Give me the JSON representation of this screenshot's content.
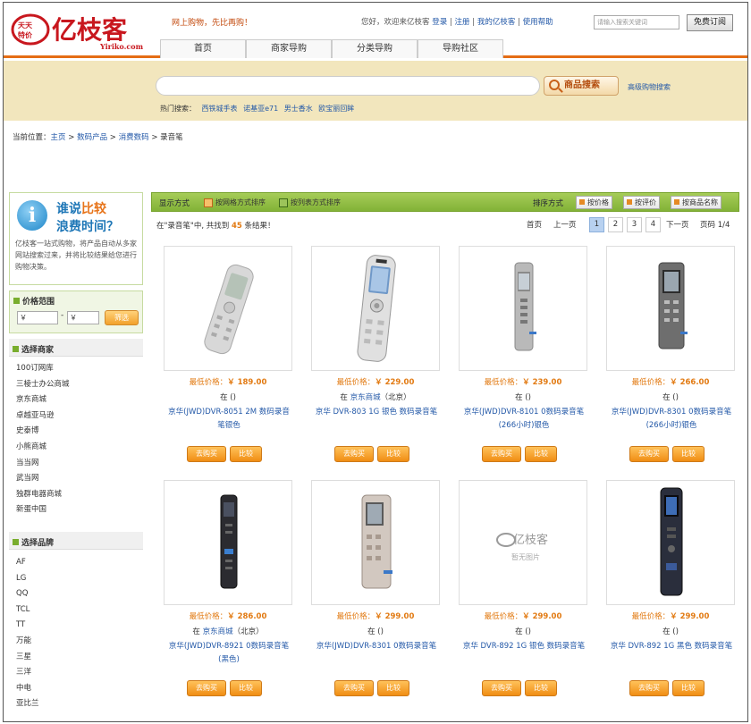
{
  "header": {
    "logo_badge": "天天特价",
    "logo_text": "亿枝客",
    "logo_domain": "Yiriko.com",
    "slogan": "网上购物，先比再购！",
    "welcome": "您好，欢迎来亿枝客",
    "links": [
      "登录",
      "注册",
      "我的亿枝客",
      "使用帮助"
    ],
    "search_placeholder": "请输入搜索关键词",
    "free_order": "免费订阅",
    "nav": [
      "首页",
      "商家导购",
      "分类导购",
      "导购社区"
    ]
  },
  "search": {
    "button": "商品搜索",
    "advanced": "高级购物搜索",
    "hot_label": "热门搜索：",
    "hot_keywords": [
      "西铁城手表",
      "诺基亚e71",
      "男士香水",
      "欧宝丽回眸"
    ]
  },
  "breadcrumb": {
    "label": "当前位置：",
    "items": [
      "主页",
      "数码产品",
      "消费数码",
      "录音笔"
    ],
    "sep": " > "
  },
  "sidebar": {
    "promo_line1a": "谁说",
    "promo_line1b": "比较",
    "promo_line2": "浪费时间？",
    "promo_desc": "亿枝客一站式购物，将产品自动从多家网站搜索过来，并将比较结果给您进行购物决策。",
    "price_title": "价格范围",
    "price_min": "￥",
    "price_max": "￥",
    "price_dash": "-",
    "price_button": "筛选",
    "merchant_title": "选择商家",
    "merchants": [
      "100订网库",
      "三棱士办公商城",
      "京东商城",
      "卓越亚马逊",
      "史泰博",
      "小熊商城",
      "当当网",
      "武当网",
      "独群电器商城",
      "新蛋中国"
    ],
    "brand_title": "选择品牌",
    "brands": [
      "AF",
      "LG",
      "QQ",
      "TCL",
      "TT",
      "万能",
      "三星",
      "三洋",
      "中电",
      "亚比兰"
    ]
  },
  "toolbar": {
    "display_label": "显示方式",
    "grid_view": "按网格方式排序",
    "list_view": "按列表方式排序",
    "sort_label": "排序方式",
    "sort_buttons": [
      "按价格",
      "按评价",
      "按商品名称"
    ]
  },
  "results": {
    "prefix": "在\"录音笔\"中, 共找到",
    "count": "45",
    "suffix": "条结果！"
  },
  "pager": {
    "first": "首页",
    "prev": "上一页",
    "pages": [
      "1",
      "2",
      "3",
      "4"
    ],
    "current": "1",
    "next": "下一页",
    "info": "页码 1/4"
  },
  "products": [
    {
      "price_label": "最低价格：",
      "price": "￥ 189.00",
      "store_prefix": "在",
      "store": "",
      "store_suffix": "()",
      "name": "京华(JWD)DVR-8051 2M 数码录音笔银色",
      "buy": "去购买",
      "compare": "比较"
    },
    {
      "price_label": "最低价格：",
      "price": "￥ 229.00",
      "store_prefix": "在",
      "store": "京东商城",
      "store_suffix": "（北京）",
      "name": "京华 DVR-803 1G 银色 数码录音笔",
      "buy": "去购买",
      "compare": "比较"
    },
    {
      "price_label": "最低价格：",
      "price": "￥ 239.00",
      "store_prefix": "在",
      "store": "",
      "store_suffix": "()",
      "name": "京华(JWD)DVR-8101 0数码录音笔(266小时)银色",
      "buy": "去购买",
      "compare": "比较"
    },
    {
      "price_label": "最低价格：",
      "price": "￥ 266.00",
      "store_prefix": "在",
      "store": "",
      "store_suffix": "()",
      "name": "京华(JWD)DVR-8301 0数码录音笔(266小时)银色",
      "buy": "去购买",
      "compare": "比较"
    },
    {
      "price_label": "最低价格：",
      "price": "￥ 286.00",
      "store_prefix": "在",
      "store": "京东商城",
      "store_suffix": "（北京）",
      "name": "京华(JWD)DVR-8921 0数码录音笔(黑色)",
      "buy": "去购买",
      "compare": "比较"
    },
    {
      "price_label": "最低价格：",
      "price": "￥ 299.00",
      "store_prefix": "在",
      "store": "",
      "store_suffix": "()",
      "name": "京华(JWD)DVR-8301 0数码录音笔",
      "buy": "去购买",
      "compare": "比较"
    },
    {
      "price_label": "最低价格：",
      "price": "￥ 299.00",
      "store_prefix": "在",
      "store": "",
      "store_suffix": "()",
      "name": "京华 DVR-892 1G 银色 数码录音笔",
      "buy": "去购买",
      "compare": "比较"
    },
    {
      "price_label": "最低价格：",
      "price": "￥ 299.00",
      "store_prefix": "在",
      "store": "",
      "store_suffix": "()",
      "name": "京华 DVR-892 1G 黑色 数码录音笔",
      "buy": "去购买",
      "compare": "比较"
    }
  ],
  "placeholder_image": {
    "brand": "亿枝客",
    "text": "暂无图片"
  },
  "colors": {
    "accent_orange": "#e56d15",
    "toolbar_green": "#8ab93f",
    "link_blue": "#2459a8",
    "price_orange": "#e27a12",
    "band_beige": "#f2e6bd"
  }
}
